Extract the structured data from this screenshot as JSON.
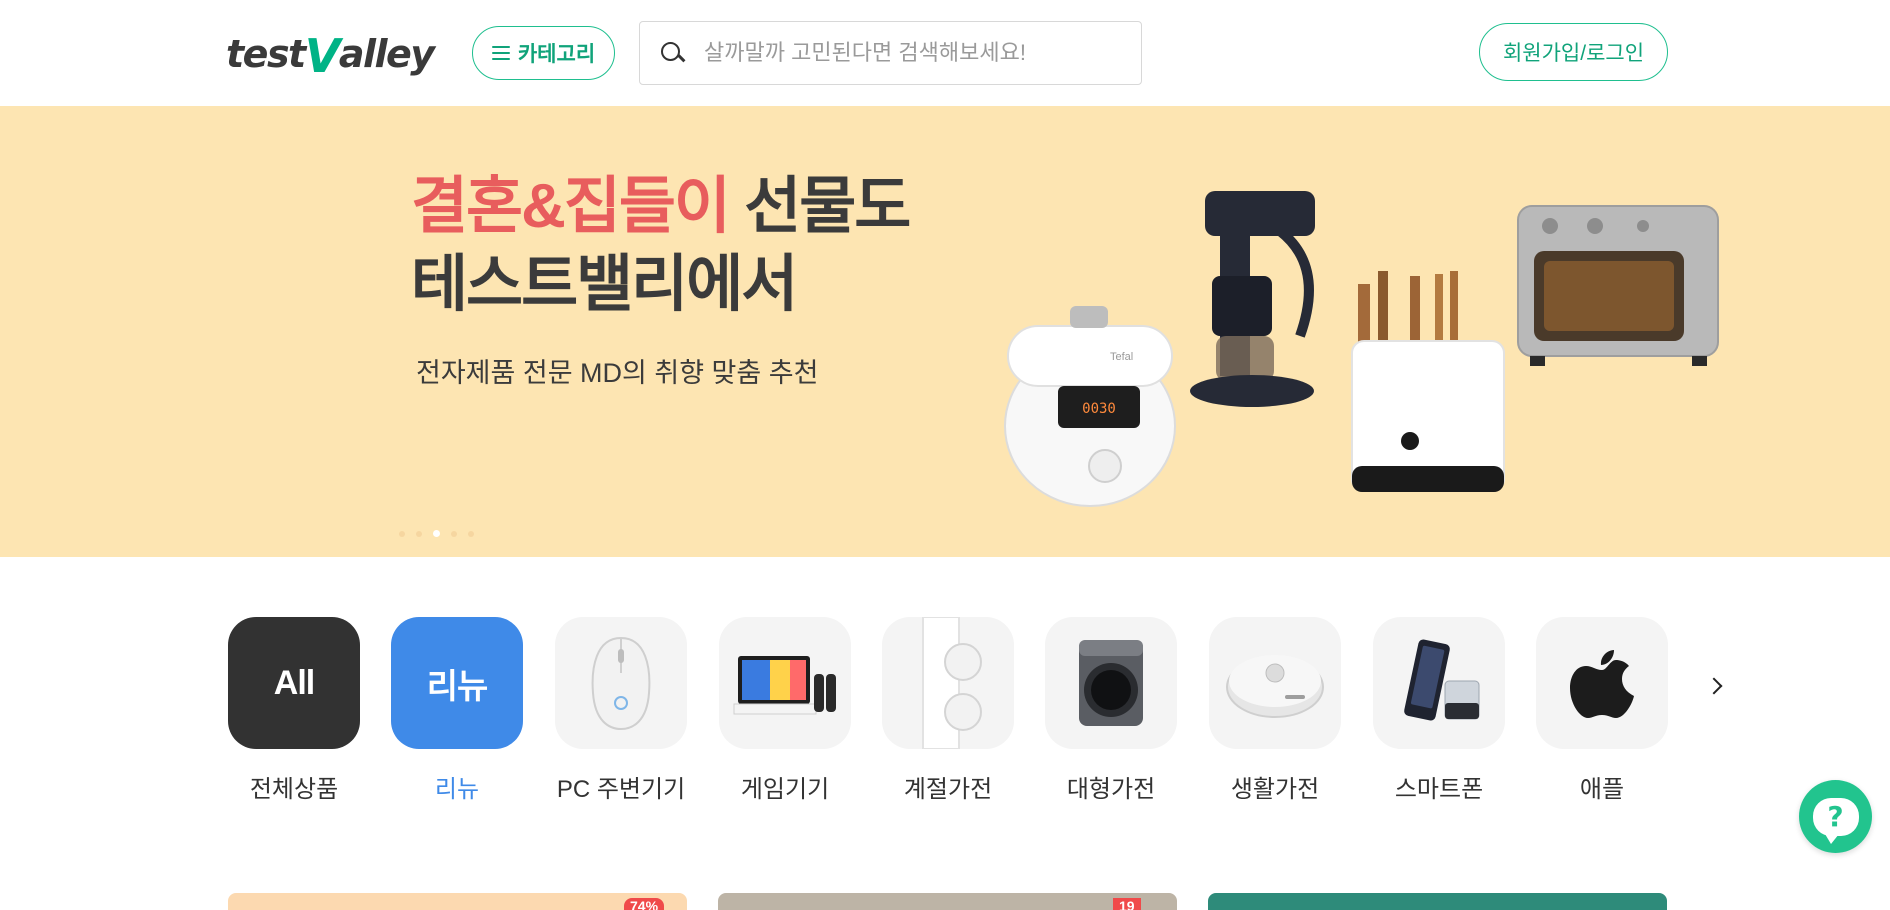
{
  "header": {
    "logo": {
      "part1": "test",
      "part2": "V",
      "part3": "alley"
    },
    "category_button_label": "카테고리",
    "search_placeholder": "살까말까 고민된다면 검색해보세요!",
    "login_button_label": "회원가입/로그인"
  },
  "banner": {
    "title_highlight": "결혼&집들이",
    "title_rest_line1": " 선물도",
    "title_line2": "테스트밸리에서",
    "subtitle": "전자제품 전문 MD의 취향 맞춤 추천",
    "slide_count": 5,
    "active_slide_index": 2,
    "product_label_cooker": "Tefal",
    "product_label_display": "0030",
    "colors": {
      "background": "#fde5b2",
      "highlight": "#e85d5d"
    }
  },
  "categories": [
    {
      "label": "전체상품",
      "tile_text": "All",
      "icon": "all-tile",
      "active": false
    },
    {
      "label": "리뉴",
      "tile_text": "리뉴",
      "icon": "renew-tile",
      "active": true
    },
    {
      "label": "PC 주변기기",
      "icon": "mouse-icon",
      "active": false
    },
    {
      "label": "게임기기",
      "icon": "game-console-icon",
      "active": false
    },
    {
      "label": "계절가전",
      "icon": "seasonal-appliance-icon",
      "active": false
    },
    {
      "label": "대형가전",
      "icon": "washer-icon",
      "active": false
    },
    {
      "label": "생활가전",
      "icon": "robot-vacuum-icon",
      "active": false
    },
    {
      "label": "스마트폰",
      "icon": "smartphone-icon",
      "active": false
    },
    {
      "label": "애플",
      "icon": "apple-icon",
      "active": false
    }
  ],
  "chat": {
    "icon": "help-chat-icon",
    "glyph": "?"
  },
  "product_cards": [
    {
      "badge": "74%"
    },
    {
      "badge": "19"
    },
    {
      "badge": ""
    }
  ]
}
